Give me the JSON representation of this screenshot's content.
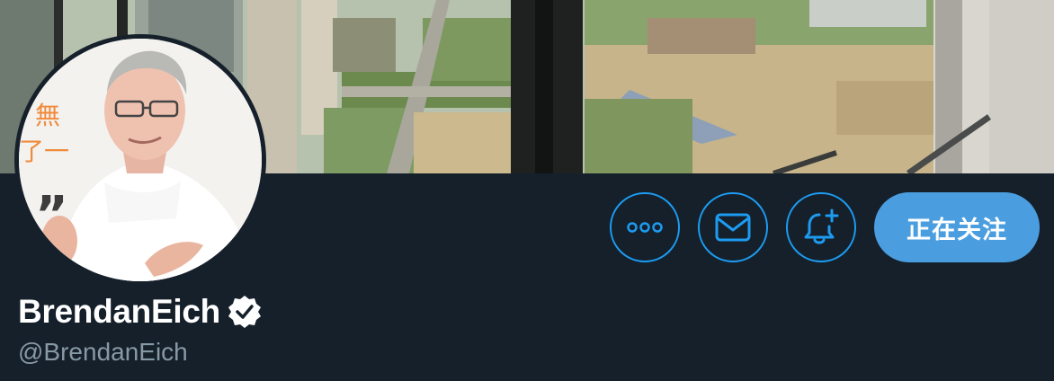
{
  "profile": {
    "display_name": "BrendanEich",
    "handle": "@BrendanEich",
    "verified": true
  },
  "avatar": {
    "background_glyphs": [
      "無",
      "了一",
      "”"
    ]
  },
  "actions": {
    "more_icon": "more-horizontal-icon",
    "message_icon": "envelope-icon",
    "notify_icon": "bell-plus-icon",
    "follow_label": "正在关注"
  },
  "colors": {
    "background": "#15202b",
    "accent": "#1d9bf0",
    "follow_button": "#4a9ee0",
    "handle_text": "#8899a6"
  }
}
